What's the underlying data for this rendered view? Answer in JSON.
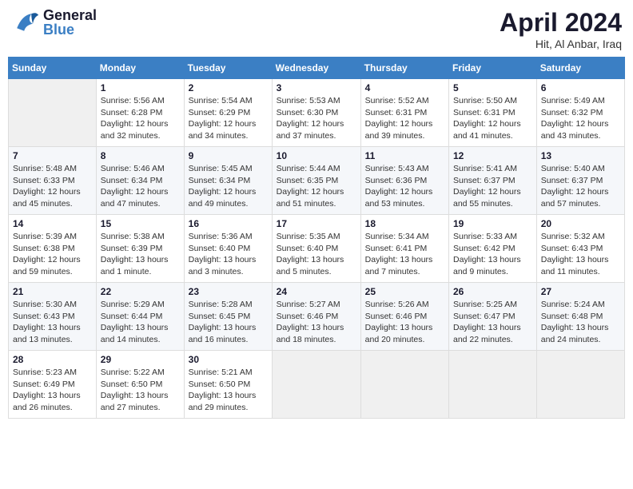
{
  "header": {
    "logo_general": "General",
    "logo_blue": "Blue",
    "title": "April 2024",
    "subtitle": "Hit, Al Anbar, Iraq"
  },
  "weekdays": [
    "Sunday",
    "Monday",
    "Tuesday",
    "Wednesday",
    "Thursday",
    "Friday",
    "Saturday"
  ],
  "weeks": [
    [
      {
        "num": "",
        "info": ""
      },
      {
        "num": "1",
        "info": "Sunrise: 5:56 AM\nSunset: 6:28 PM\nDaylight: 12 hours\nand 32 minutes."
      },
      {
        "num": "2",
        "info": "Sunrise: 5:54 AM\nSunset: 6:29 PM\nDaylight: 12 hours\nand 34 minutes."
      },
      {
        "num": "3",
        "info": "Sunrise: 5:53 AM\nSunset: 6:30 PM\nDaylight: 12 hours\nand 37 minutes."
      },
      {
        "num": "4",
        "info": "Sunrise: 5:52 AM\nSunset: 6:31 PM\nDaylight: 12 hours\nand 39 minutes."
      },
      {
        "num": "5",
        "info": "Sunrise: 5:50 AM\nSunset: 6:31 PM\nDaylight: 12 hours\nand 41 minutes."
      },
      {
        "num": "6",
        "info": "Sunrise: 5:49 AM\nSunset: 6:32 PM\nDaylight: 12 hours\nand 43 minutes."
      }
    ],
    [
      {
        "num": "7",
        "info": "Sunrise: 5:48 AM\nSunset: 6:33 PM\nDaylight: 12 hours\nand 45 minutes."
      },
      {
        "num": "8",
        "info": "Sunrise: 5:46 AM\nSunset: 6:34 PM\nDaylight: 12 hours\nand 47 minutes."
      },
      {
        "num": "9",
        "info": "Sunrise: 5:45 AM\nSunset: 6:34 PM\nDaylight: 12 hours\nand 49 minutes."
      },
      {
        "num": "10",
        "info": "Sunrise: 5:44 AM\nSunset: 6:35 PM\nDaylight: 12 hours\nand 51 minutes."
      },
      {
        "num": "11",
        "info": "Sunrise: 5:43 AM\nSunset: 6:36 PM\nDaylight: 12 hours\nand 53 minutes."
      },
      {
        "num": "12",
        "info": "Sunrise: 5:41 AM\nSunset: 6:37 PM\nDaylight: 12 hours\nand 55 minutes."
      },
      {
        "num": "13",
        "info": "Sunrise: 5:40 AM\nSunset: 6:37 PM\nDaylight: 12 hours\nand 57 minutes."
      }
    ],
    [
      {
        "num": "14",
        "info": "Sunrise: 5:39 AM\nSunset: 6:38 PM\nDaylight: 12 hours\nand 59 minutes."
      },
      {
        "num": "15",
        "info": "Sunrise: 5:38 AM\nSunset: 6:39 PM\nDaylight: 13 hours\nand 1 minute."
      },
      {
        "num": "16",
        "info": "Sunrise: 5:36 AM\nSunset: 6:40 PM\nDaylight: 13 hours\nand 3 minutes."
      },
      {
        "num": "17",
        "info": "Sunrise: 5:35 AM\nSunset: 6:40 PM\nDaylight: 13 hours\nand 5 minutes."
      },
      {
        "num": "18",
        "info": "Sunrise: 5:34 AM\nSunset: 6:41 PM\nDaylight: 13 hours\nand 7 minutes."
      },
      {
        "num": "19",
        "info": "Sunrise: 5:33 AM\nSunset: 6:42 PM\nDaylight: 13 hours\nand 9 minutes."
      },
      {
        "num": "20",
        "info": "Sunrise: 5:32 AM\nSunset: 6:43 PM\nDaylight: 13 hours\nand 11 minutes."
      }
    ],
    [
      {
        "num": "21",
        "info": "Sunrise: 5:30 AM\nSunset: 6:43 PM\nDaylight: 13 hours\nand 13 minutes."
      },
      {
        "num": "22",
        "info": "Sunrise: 5:29 AM\nSunset: 6:44 PM\nDaylight: 13 hours\nand 14 minutes."
      },
      {
        "num": "23",
        "info": "Sunrise: 5:28 AM\nSunset: 6:45 PM\nDaylight: 13 hours\nand 16 minutes."
      },
      {
        "num": "24",
        "info": "Sunrise: 5:27 AM\nSunset: 6:46 PM\nDaylight: 13 hours\nand 18 minutes."
      },
      {
        "num": "25",
        "info": "Sunrise: 5:26 AM\nSunset: 6:46 PM\nDaylight: 13 hours\nand 20 minutes."
      },
      {
        "num": "26",
        "info": "Sunrise: 5:25 AM\nSunset: 6:47 PM\nDaylight: 13 hours\nand 22 minutes."
      },
      {
        "num": "27",
        "info": "Sunrise: 5:24 AM\nSunset: 6:48 PM\nDaylight: 13 hours\nand 24 minutes."
      }
    ],
    [
      {
        "num": "28",
        "info": "Sunrise: 5:23 AM\nSunset: 6:49 PM\nDaylight: 13 hours\nand 26 minutes."
      },
      {
        "num": "29",
        "info": "Sunrise: 5:22 AM\nSunset: 6:50 PM\nDaylight: 13 hours\nand 27 minutes."
      },
      {
        "num": "30",
        "info": "Sunrise: 5:21 AM\nSunset: 6:50 PM\nDaylight: 13 hours\nand 29 minutes."
      },
      {
        "num": "",
        "info": ""
      },
      {
        "num": "",
        "info": ""
      },
      {
        "num": "",
        "info": ""
      },
      {
        "num": "",
        "info": ""
      }
    ]
  ]
}
